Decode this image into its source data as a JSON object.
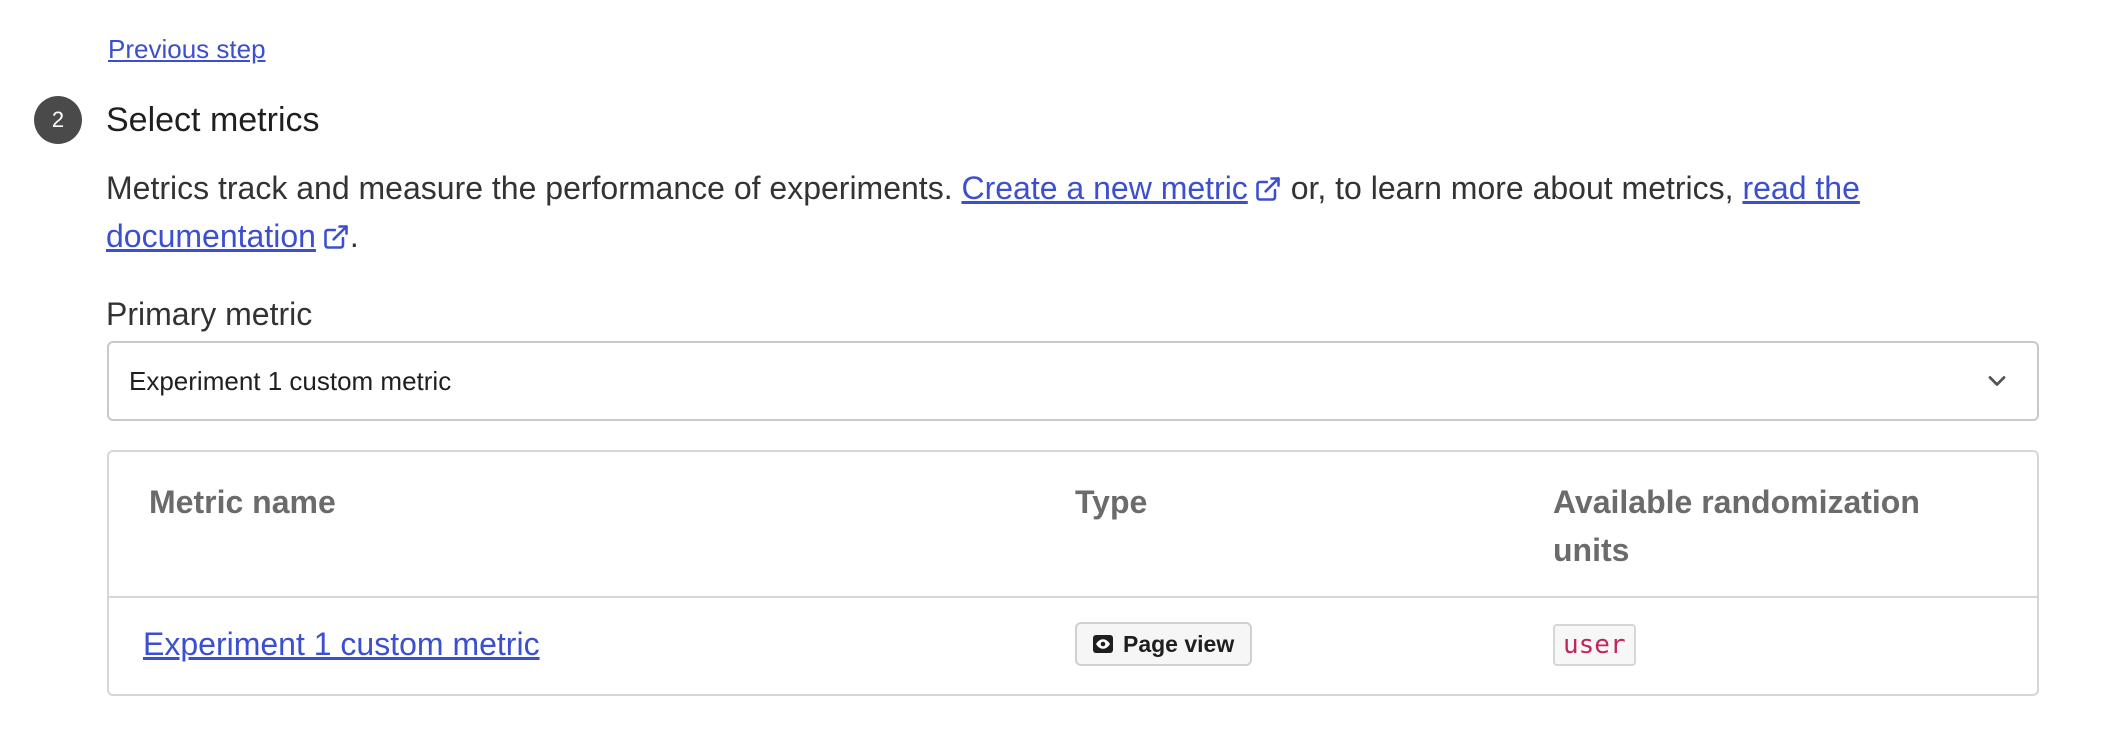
{
  "nav": {
    "previous_step_label": "Previous step"
  },
  "step": {
    "number": "2",
    "title": "Select metrics"
  },
  "description": {
    "text_before": "Metrics track and measure the performance of experiments. ",
    "create_link_label": "Create a new metric",
    "text_middle": " or, to learn more about metrics, ",
    "docs_link_label": "read the documentation",
    "text_after": "."
  },
  "primary_metric": {
    "label": "Primary metric",
    "selected_value": "Experiment 1 custom metric"
  },
  "table": {
    "columns": [
      "Metric name",
      "Type",
      "Available randomization units"
    ],
    "rows": [
      {
        "metric_name": "Experiment 1 custom metric",
        "type": "Page view",
        "type_icon": "eye-icon",
        "units": [
          "user"
        ]
      }
    ]
  },
  "colors": {
    "link": "#3b4fcf",
    "badge": "#4a4a4a",
    "code_text": "#c2255c"
  }
}
